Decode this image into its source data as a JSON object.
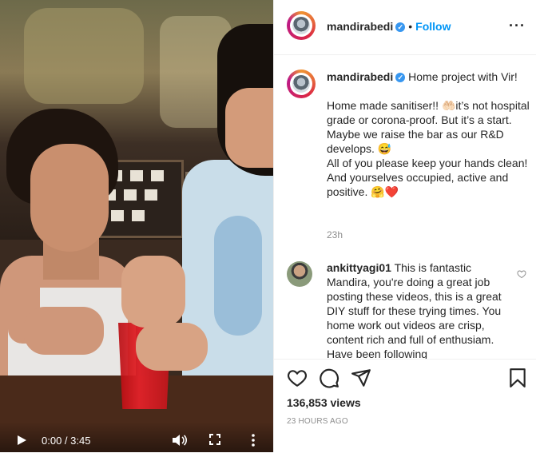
{
  "video": {
    "time": "0:00 / 3:45",
    "icons": [
      "play-icon",
      "volume-icon",
      "fullscreen-icon",
      "more-vertical-icon"
    ]
  },
  "header": {
    "username": "mandirabedi",
    "separator": "•",
    "follow_label": "Follow",
    "more_label": "···"
  },
  "caption": {
    "username": "mandirabedi",
    "lines": [
      "Home project with Vir!",
      "",
      "Home made sanitiser!! 🤲🏻it’s not hospital grade or corona-proof. But it’s a start. Maybe we raise the bar as our R&D develops. 😅",
      "All of you please keep your hands clean! And yourselves occupied, active and positive. 🤗❤️"
    ],
    "time_ago": "23h"
  },
  "comment": {
    "username": "ankittyagi01",
    "text": "This is fantastic Mandira, you're doing a great job posting these videos, this is a great DIY stuff for these trying times. You home work out videos are crisp, content rich and full of enthusiam. Have been following"
  },
  "actions": {
    "views": "136,853 views",
    "date": "23 HOURS AGO",
    "icons": [
      "heart-icon",
      "comment-icon",
      "share-icon",
      "bookmark-icon"
    ]
  },
  "colors": {
    "link_blue": "#0095f6",
    "verified_blue": "#3897f0",
    "text": "#262626",
    "muted": "#8e8e8e",
    "cup_red": "#e8222a"
  }
}
